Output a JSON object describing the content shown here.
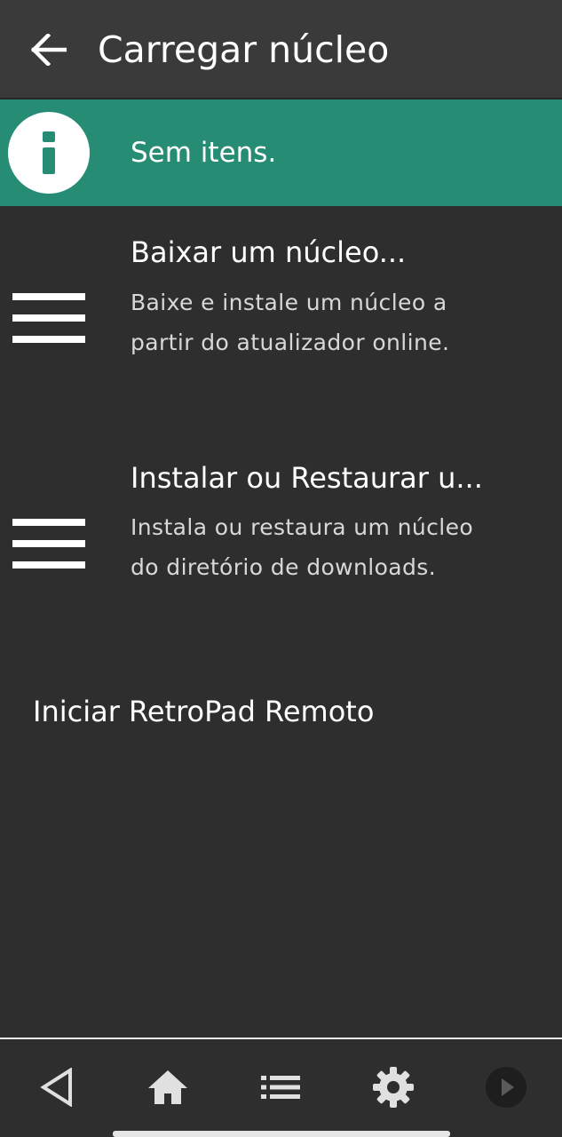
{
  "header": {
    "title": "Carregar núcleo",
    "back_icon": "arrow-left-icon"
  },
  "info_banner": {
    "message": "Sem itens.",
    "icon": "info-icon",
    "color": "#268c74"
  },
  "menu": {
    "items": [
      {
        "title": "Baixar um núcleo...",
        "description": "Baixe e instale um núcleo a partir do atualizador online.",
        "icon": "hamburger-icon"
      },
      {
        "title": "Instalar ou Restaurar u...",
        "description": "Instala ou restaura um núcleo do diretório de downloads.",
        "icon": "hamburger-icon"
      },
      {
        "title": "Iniciar RetroPad Remoto"
      }
    ]
  },
  "bottom_nav": {
    "buttons": [
      {
        "icon": "back-triangle-icon"
      },
      {
        "icon": "home-icon"
      },
      {
        "icon": "list-icon"
      },
      {
        "icon": "gear-icon"
      },
      {
        "icon": "play-icon"
      }
    ]
  },
  "colors": {
    "background": "#2e2e2e",
    "topbar": "#3a3a3a",
    "accent": "#268c74",
    "text": "#ffffff",
    "subtext": "#d8d8d8"
  }
}
